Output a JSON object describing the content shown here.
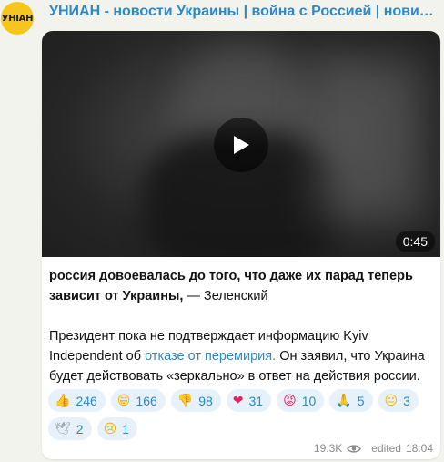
{
  "channel": {
    "avatar_text": "УНІАН",
    "title": "УНИАН - новости Украины | война с Россией | новини України..."
  },
  "video": {
    "duration": "0:45"
  },
  "message": {
    "bold_text": "россия довоевалась до того, что даже их парад теперь зависит от Украины,",
    "attribution": " — Зеленский",
    "para2_before": "Президент пока не подтверждает информацию Kyiv Independent об ",
    "para2_link": "отказе от перемирия.",
    "para2_after": " Он заявил, что Украина будет действовать «зеркально» в ответ на действия россии."
  },
  "reactions": [
    {
      "icon": "thumbs-up-icon",
      "glyph": "👍",
      "count": "246",
      "color": "#f5b400"
    },
    {
      "icon": "grinning-face-icon",
      "glyph": "😁",
      "count": "166",
      "color": "#f5b400"
    },
    {
      "icon": "thumbs-down-icon",
      "glyph": "👎",
      "count": "98",
      "color": "#f5b400"
    },
    {
      "icon": "red-heart-icon",
      "glyph": "❤",
      "count": "31",
      "color": "#e0245e"
    },
    {
      "icon": "angry-face-icon",
      "glyph": "😡",
      "count": "10",
      "color": "#e0245e"
    },
    {
      "icon": "folded-hands-icon",
      "glyph": "🙏",
      "count": "5",
      "color": "#f5b400"
    },
    {
      "icon": "neutral-face-icon",
      "glyph": "😐",
      "count": "3",
      "color": "#f5b400"
    },
    {
      "icon": "dove-icon",
      "glyph": "🕊",
      "count": "2",
      "color": "#9aa7b0"
    },
    {
      "icon": "crying-face-icon",
      "glyph": "😢",
      "count": "1",
      "color": "#f5b400"
    }
  ],
  "footer": {
    "views": "19.3K",
    "edited": "edited",
    "time": "18:04"
  },
  "colors": {
    "accent": "#2e88c5",
    "background": "#f2f3ec",
    "reaction_bg": "#e6f1f9"
  }
}
